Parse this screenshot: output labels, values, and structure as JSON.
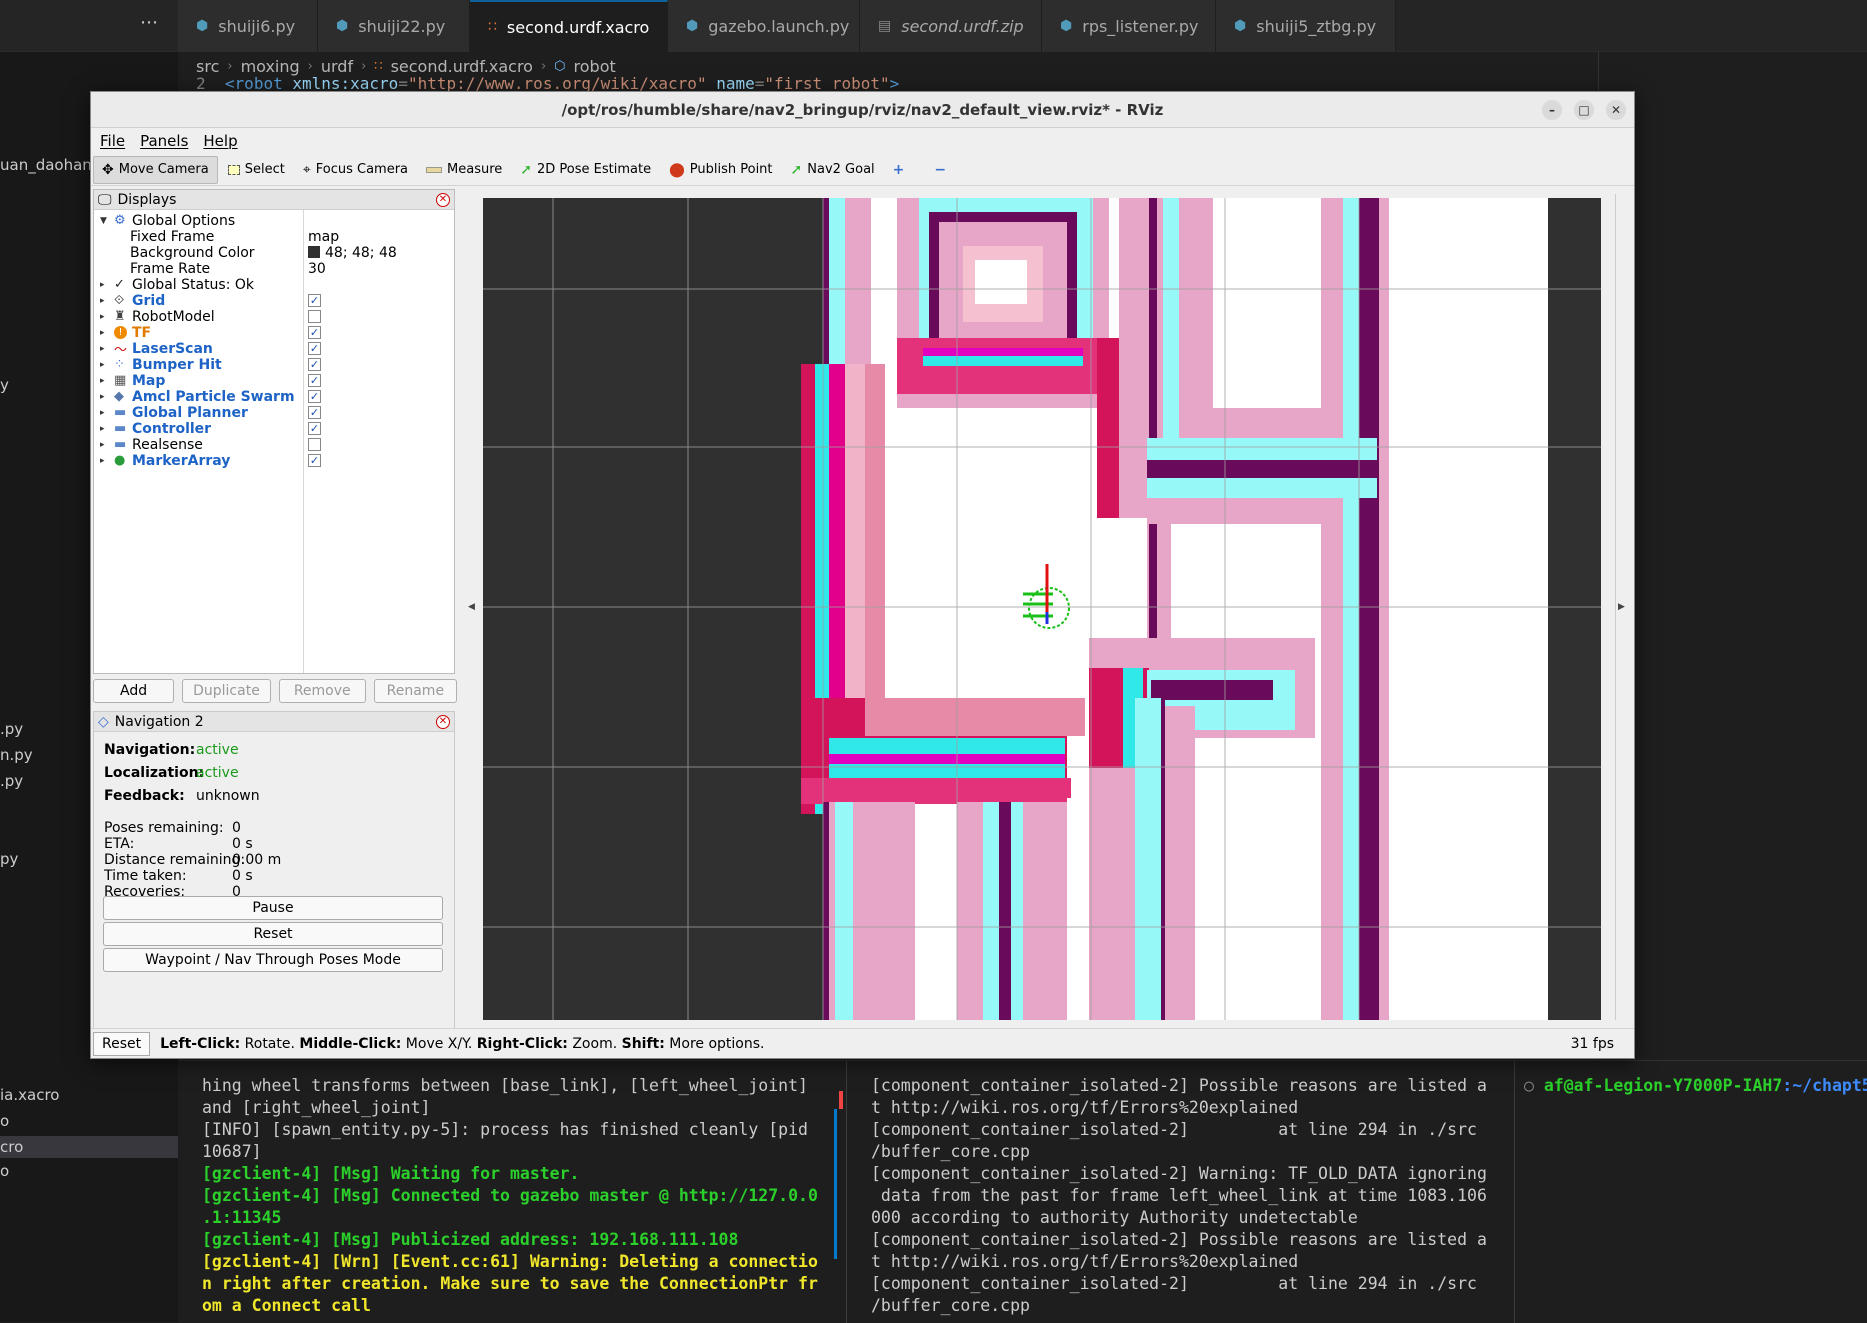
{
  "vscode": {
    "more_icon": "ellipsis-icon",
    "tabs": [
      {
        "label": "shuiji6.py",
        "icon": "python-icon"
      },
      {
        "label": "shuiji22.py",
        "icon": "python-icon"
      },
      {
        "label": "second.urdf.xacro",
        "icon": "rss-icon",
        "active": true
      },
      {
        "label": "gazebo.launch.py",
        "icon": "python-icon"
      },
      {
        "label": "second.urdf.zip",
        "icon": "zip-icon"
      },
      {
        "label": "rps_listener.py",
        "icon": "python-icon"
      },
      {
        "label": "shuiji5_ztbg.py",
        "icon": "python-icon"
      }
    ],
    "breadcrumb": [
      "src",
      "moxing",
      "urdf",
      "second.urdf.xacro",
      "robot"
    ],
    "code_line_number": "2",
    "code_line": {
      "open": "<",
      "tag": "robot",
      "attr1": " xmlns:xacro",
      "eq1": "=",
      "val1": "\"http://www.ros.org/wiki/xacro\"",
      "attr2": " name",
      "eq2": "=",
      "val2": "\"first_robot\"",
      "close": ">"
    },
    "sidebar_items": [
      "uan_daohang",
      "y",
      ".py",
      "n.py",
      ".py",
      "py",
      "ia.xacro",
      "o",
      "cro",
      "o"
    ]
  },
  "rviz": {
    "title": "/opt/ros/humble/share/nav2_bringup/rviz/nav2_default_view.rviz* - RViz",
    "window_buttons": {
      "minimize": "–",
      "maximize": "□",
      "close": "✕"
    },
    "menu": [
      "File",
      "Panels",
      "Help"
    ],
    "toolbar": [
      {
        "label": "Move Camera",
        "icon": "move-camera-icon",
        "active": true
      },
      {
        "label": "Select",
        "icon": "select-icon"
      },
      {
        "label": "Focus Camera",
        "icon": "focus-camera-icon"
      },
      {
        "label": "Measure",
        "icon": "measure-icon"
      },
      {
        "label": "2D Pose Estimate",
        "icon": "pose-estimate-icon"
      },
      {
        "label": "Publish Point",
        "icon": "publish-point-icon"
      },
      {
        "label": "Nav2 Goal",
        "icon": "nav2-goal-icon"
      }
    ],
    "displays": {
      "title": "Displays",
      "global_options": "Global Options",
      "fixed_frame": {
        "label": "Fixed Frame",
        "value": "map"
      },
      "background_color": {
        "label": "Background Color",
        "value": "48; 48; 48",
        "color": "#303030"
      },
      "frame_rate": {
        "label": "Frame Rate",
        "value": "30"
      },
      "global_status": "Global Status: Ok",
      "items": [
        {
          "label": "Grid",
          "checked": true,
          "icon": "grid-icon"
        },
        {
          "label": "RobotModel",
          "checked": false,
          "icon": "robot-model-icon"
        },
        {
          "label": "TF",
          "checked": true,
          "icon": "warning-icon"
        },
        {
          "label": "LaserScan",
          "checked": true,
          "icon": "laserscan-icon"
        },
        {
          "label": "Bumper Hit",
          "checked": true,
          "icon": "bumper-hit-icon"
        },
        {
          "label": "Map",
          "checked": true,
          "icon": "map-icon"
        },
        {
          "label": "Amcl Particle Swarm",
          "checked": true,
          "icon": "particle-swarm-icon"
        },
        {
          "label": "Global Planner",
          "checked": true,
          "icon": "folder-icon"
        },
        {
          "label": "Controller",
          "checked": true,
          "icon": "folder-icon"
        },
        {
          "label": "Realsense",
          "checked": false,
          "icon": "folder-icon"
        },
        {
          "label": "MarkerArray",
          "checked": true,
          "icon": "marker-array-icon"
        }
      ],
      "buttons": {
        "add": "Add",
        "duplicate": "Duplicate",
        "remove": "Remove",
        "rename": "Rename"
      }
    },
    "nav2": {
      "title": "Navigation 2",
      "navigation": {
        "label": "Navigation:",
        "value": "active"
      },
      "localization": {
        "label": "Localization:",
        "value": "active"
      },
      "feedback": {
        "label": "Feedback:",
        "value": "unknown"
      },
      "stats": [
        {
          "label": "Poses remaining:",
          "value": "0"
        },
        {
          "label": "ETA:",
          "value": "0 s"
        },
        {
          "label": "Distance remaining:",
          "value": "0.00 m"
        },
        {
          "label": "Time taken:",
          "value": "0 s"
        },
        {
          "label": "Recoveries:",
          "value": "0"
        }
      ],
      "pause": "Pause",
      "reset": "Reset",
      "waypoint_mode": "Waypoint / Nav Through Poses Mode"
    },
    "status": {
      "reset": "Reset",
      "help": [
        {
          "b": "Left-Click:",
          "t": " Rotate. "
        },
        {
          "b": "Middle-Click:",
          "t": " Move X/Y. "
        },
        {
          "b": "Right-Click:",
          "t": " Zoom. "
        },
        {
          "b": "Shift:",
          "t": " More options."
        }
      ],
      "fps": "31 fps"
    }
  },
  "terminal": {
    "col1": [
      {
        "t": "hing wheel transforms between [base_link], [left_wheel_joint]",
        "c": ""
      },
      {
        "t": "and [right_wheel_joint]",
        "c": ""
      },
      {
        "t": "[INFO] [spawn_entity.py-5]: process has finished cleanly [pid",
        "c": ""
      },
      {
        "t": "10687]",
        "c": ""
      },
      {
        "t": "[gzclient-4] [Msg] Waiting for master.",
        "c": "g"
      },
      {
        "t": "[gzclient-4] [Msg] Connected to gazebo master @ http://127.0.0",
        "c": "g"
      },
      {
        "t": ".1:11345",
        "c": "g"
      },
      {
        "t": "[gzclient-4] [Msg] Publicized address: 192.168.111.108",
        "c": "g"
      },
      {
        "t": "[gzclient-4] [Wrn] [Event.cc:61] Warning: Deleting a connectio",
        "c": "y"
      },
      {
        "t": "n right after creation. Make sure to save the ConnectionPtr fr",
        "c": "y"
      },
      {
        "t": "om a Connect call",
        "c": "y"
      }
    ],
    "col2": [
      "[component_container_isolated-2] Possible reasons are listed a",
      "t http://wiki.ros.org/tf/Errors%20explained",
      "[component_container_isolated-2]         at line 294 in ./src",
      "/buffer_core.cpp",
      "[component_container_isolated-2] Warning: TF_OLD_DATA ignoring",
      " data from the past for frame left_wheel_link at time 1083.106",
      "000 according to authority Authority undetectable",
      "[component_container_isolated-2] Possible reasons are listed a",
      "t http://wiki.ros.org/tf/Errors%20explained",
      "[component_container_isolated-2]         at line 294 in ./src",
      "/buffer_core.cpp"
    ],
    "prompt_user": "af@af-Legion-Y7000P-IAH7",
    "prompt_path": ":~/chapt5"
  }
}
